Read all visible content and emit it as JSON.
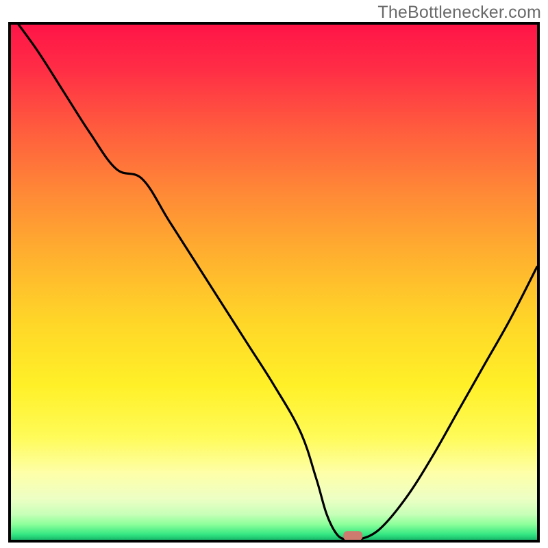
{
  "attribution": "TheBottlenecker.com",
  "chart_data": {
    "type": "line",
    "title": "",
    "xlabel": "",
    "ylabel": "",
    "xlim": [
      0,
      100
    ],
    "ylim": [
      0,
      100
    ],
    "series": [
      {
        "name": "bottleneck-curve",
        "x": [
          0,
          5,
          10,
          15,
          20,
          25,
          30,
          35,
          40,
          45,
          50,
          55,
          58,
          60,
          62,
          64,
          66,
          70,
          75,
          80,
          85,
          90,
          95,
          100
        ],
        "y": [
          102,
          95,
          87,
          79,
          72,
          70,
          62,
          54,
          46,
          38,
          30,
          21,
          12,
          5,
          1,
          0,
          0,
          2,
          8,
          16,
          25,
          34,
          43,
          53
        ]
      }
    ],
    "marker": {
      "x": 65,
      "y": 0.5,
      "color": "#cd7b6f",
      "name": "selected-point"
    },
    "background": {
      "type": "vertical-gradient",
      "stops": [
        {
          "pos": 0.0,
          "color": "#ff1547"
        },
        {
          "pos": 0.2,
          "color": "#ff5b3e"
        },
        {
          "pos": 0.46,
          "color": "#ffb42e"
        },
        {
          "pos": 0.7,
          "color": "#fff028"
        },
        {
          "pos": 0.87,
          "color": "#feffa8"
        },
        {
          "pos": 0.97,
          "color": "#8cff9a"
        },
        {
          "pos": 1.0,
          "color": "#18b76a"
        }
      ]
    }
  }
}
